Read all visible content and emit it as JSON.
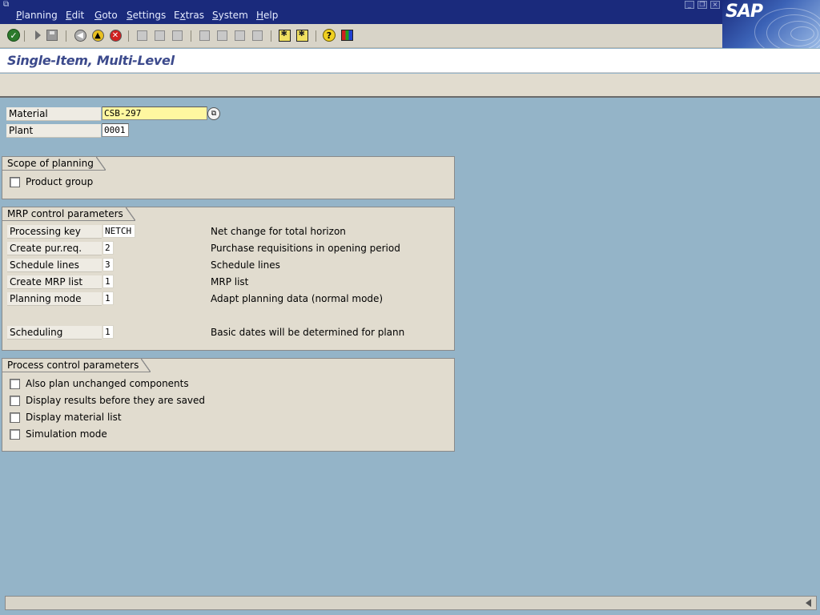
{
  "menubar": {
    "items": [
      {
        "label": "Planning",
        "accel": "P"
      },
      {
        "label": "Edit",
        "accel": "E"
      },
      {
        "label": "Goto",
        "accel": "G"
      },
      {
        "label": "Settings",
        "accel": "S"
      },
      {
        "label": "Extras",
        "accel": "x"
      },
      {
        "label": "System",
        "accel": "S"
      },
      {
        "label": "Help",
        "accel": "H"
      }
    ],
    "logo": "SAP"
  },
  "toolbar": {
    "icons": [
      "enter-icon",
      "command-field-icon",
      "save-icon",
      "back-icon",
      "exit-icon",
      "cancel-icon",
      "print-icon",
      "find-icon",
      "find-next-icon",
      "first-page-icon",
      "previous-page-icon",
      "next-page-icon",
      "last-page-icon",
      "create-session-icon",
      "create-shortcut-icon",
      "help-icon",
      "customize-layout-icon"
    ]
  },
  "title": "Single-Item, Multi-Level",
  "header_fields": {
    "material": {
      "label": "Material",
      "value": "CSB-297"
    },
    "plant": {
      "label": "Plant",
      "value": "0001"
    }
  },
  "scope_of_planning": {
    "title": "Scope of planning",
    "checkboxes": [
      {
        "label": "Product group",
        "checked": false
      }
    ]
  },
  "mrp_control": {
    "title": "MRP control parameters",
    "rows": [
      {
        "label": "Processing key",
        "value": "NETCH",
        "description": "Net change for total horizon"
      },
      {
        "label": "Create pur.req.",
        "value": "2",
        "description": "Purchase requisitions in opening period"
      },
      {
        "label": "Schedule lines",
        "value": "3",
        "description": "Schedule lines"
      },
      {
        "label": "Create MRP list",
        "value": "1",
        "description": "MRP list"
      },
      {
        "label": "Planning mode",
        "value": "1",
        "description": "Adapt planning data (normal mode)"
      },
      {
        "label": "Scheduling",
        "value": "1",
        "description": "Basic dates will be determined for plann"
      }
    ]
  },
  "process_control": {
    "title": "Process control parameters",
    "checkboxes": [
      {
        "label": "Also plan unchanged components",
        "checked": false
      },
      {
        "label": "Display results before they are saved",
        "checked": false
      },
      {
        "label": "Display material list",
        "checked": false
      },
      {
        "label": "Simulation mode",
        "checked": false
      }
    ]
  },
  "colors": {
    "menubar_bg": "#1a2a7c",
    "workspace_bg": "#94b4c8",
    "panel_bg": "#e1dccf",
    "title_text": "#3c4a8c",
    "required_field": "#fff7a0"
  }
}
